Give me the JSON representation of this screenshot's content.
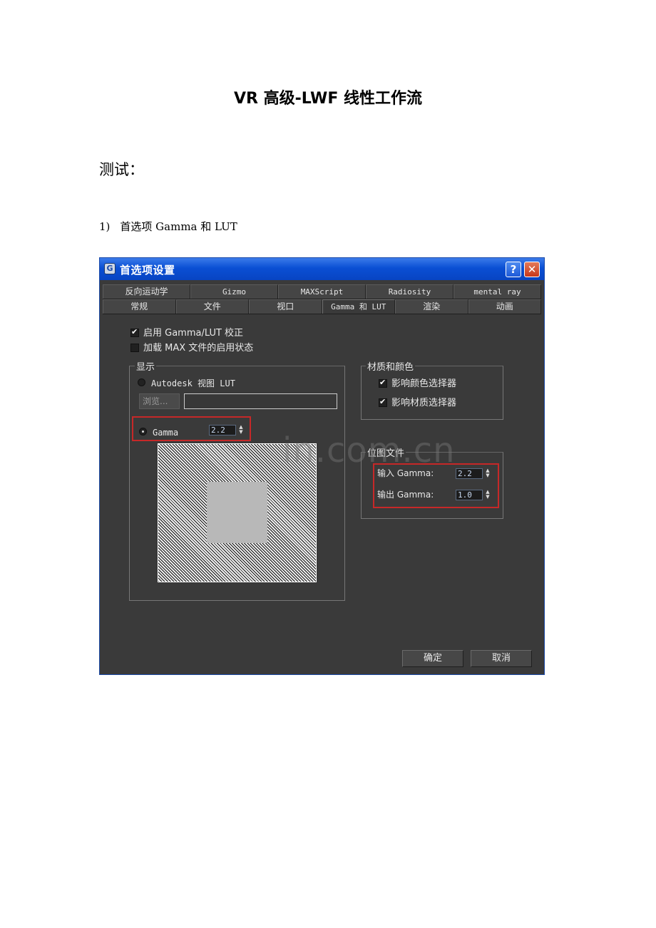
{
  "document": {
    "title": "VR 高级-LWF 线性工作流",
    "section_heading": "测试：",
    "step_number": "1)",
    "step_text": "首选项 Gamma 和 LUT"
  },
  "dialog": {
    "title": "首选项设置",
    "help_label": "?",
    "close_label": "✕",
    "tabs_row1": [
      "反向运动学",
      "Gizmo",
      "MAXScript",
      "Radiosity",
      "mental ray"
    ],
    "tabs_row2": [
      "常规",
      "文件",
      "视口",
      "Gamma 和 LUT",
      "渲染",
      "动画"
    ],
    "active_tab": "Gamma 和 LUT",
    "enable_checkbox": {
      "label": "启用 Gamma/LUT 校正",
      "checked": true
    },
    "load_checkbox": {
      "label": "加载 MAX 文件的启用状态",
      "checked": false
    },
    "display_group": {
      "label": "显示",
      "lut_option": "Autodesk 视图 LUT",
      "browse_label": "浏览...",
      "gamma_option": "Gamma",
      "gamma_value": "2.2",
      "selected": "Gamma"
    },
    "material_group": {
      "label": "材质和颜色",
      "color_picker": {
        "label": "影响颜色选择器",
        "checked": true
      },
      "material_picker": {
        "label": "影响材质选择器",
        "checked": true
      }
    },
    "bitmap_group": {
      "label": "位图文件",
      "input_gamma_label": "输入 Gamma:",
      "input_gamma_value": "2.2",
      "output_gamma_label": "输出 Gamma:",
      "output_gamma_value": "1.0"
    },
    "ok_label": "确定",
    "cancel_label": "取消"
  },
  "watermark": "in.com.cn",
  "colors": {
    "titlebar": "#0a4fd4",
    "dialog_bg": "#3a3a3a",
    "highlight_box": "#c62828"
  }
}
